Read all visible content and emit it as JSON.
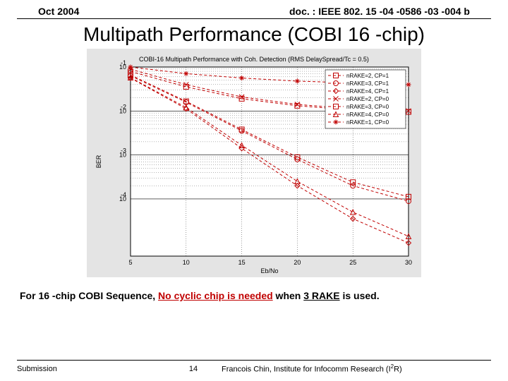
{
  "header": {
    "date": "Oct 2004",
    "doc": "doc. : IEEE 802. 15 -04 -0586 -03 -004 b"
  },
  "title": "Multipath Performance (COBI 16 -chip)",
  "caption": {
    "prefix": "For 16 -chip COBI Sequence, ",
    "highlight": "No cyclic chip is needed",
    "mid": " when ",
    "uline": "3 RAKE",
    "suffix": " is used."
  },
  "footer": {
    "submission": "Submission",
    "page": "14",
    "affiliation": "Francois Chin, Institute for Infocomm Research (I",
    "affiliation_sup": "2",
    "affiliation_tail": "R)"
  },
  "chart_data": {
    "type": "line",
    "title": "COBI-16 Multipath Performance with Coh. Detection (RMS DelaySpread/Tc = 0.5)",
    "xlabel": "Eb/No",
    "ylabel": "BER",
    "xlim": [
      5,
      30
    ],
    "ylim_log10": [
      -5.3,
      -1
    ],
    "xticks": [
      5,
      10,
      15,
      20,
      25,
      30
    ],
    "yticks_log10": [
      -1,
      -2,
      -3,
      -4
    ],
    "x": [
      5,
      10,
      15,
      20,
      25,
      30
    ],
    "series": [
      {
        "name": "nRAKE=2, CP=1",
        "color": "#c00000",
        "marker": "square",
        "dash": "4 3",
        "values_log10": [
          -1.1,
          -1.45,
          -1.72,
          -1.88,
          -1.98,
          -2.02
        ]
      },
      {
        "name": "nRAKE=3, CP=1",
        "color": "#c00000",
        "marker": "circle",
        "dash": "4 3",
        "values_log10": [
          -1.2,
          -1.8,
          -2.45,
          -3.1,
          -3.7,
          -4.05
        ]
      },
      {
        "name": "nRAKE=4, CP=1",
        "color": "#c00000",
        "marker": "diamond",
        "dash": "4 3",
        "values_log10": [
          -1.25,
          -1.95,
          -2.85,
          -3.7,
          -4.45,
          -5.0
        ]
      },
      {
        "name": "nRAKE=2, CP=0",
        "color": "#c00000",
        "marker": "x",
        "dash": "4 3",
        "values_log10": [
          -1.05,
          -1.4,
          -1.68,
          -1.85,
          -1.95,
          -2.0
        ]
      },
      {
        "name": "nRAKE=3, CP=0",
        "color": "#c00000",
        "marker": "sq-open",
        "dash": "4 3",
        "values_log10": [
          -1.18,
          -1.78,
          -2.42,
          -3.05,
          -3.62,
          -3.95
        ]
      },
      {
        "name": "nRAKE=4, CP=0",
        "color": "#c00000",
        "marker": "tri-open",
        "dash": "4 3",
        "values_log10": [
          -1.24,
          -1.92,
          -2.78,
          -3.6,
          -4.3,
          -4.85
        ]
      },
      {
        "name": "nRAKE=1, CP=0",
        "color": "#c00000",
        "marker": "star",
        "dash": "4 3",
        "values_log10": [
          -1.0,
          -1.15,
          -1.25,
          -1.32,
          -1.36,
          -1.4
        ]
      }
    ],
    "legend_position": "top-right"
  }
}
